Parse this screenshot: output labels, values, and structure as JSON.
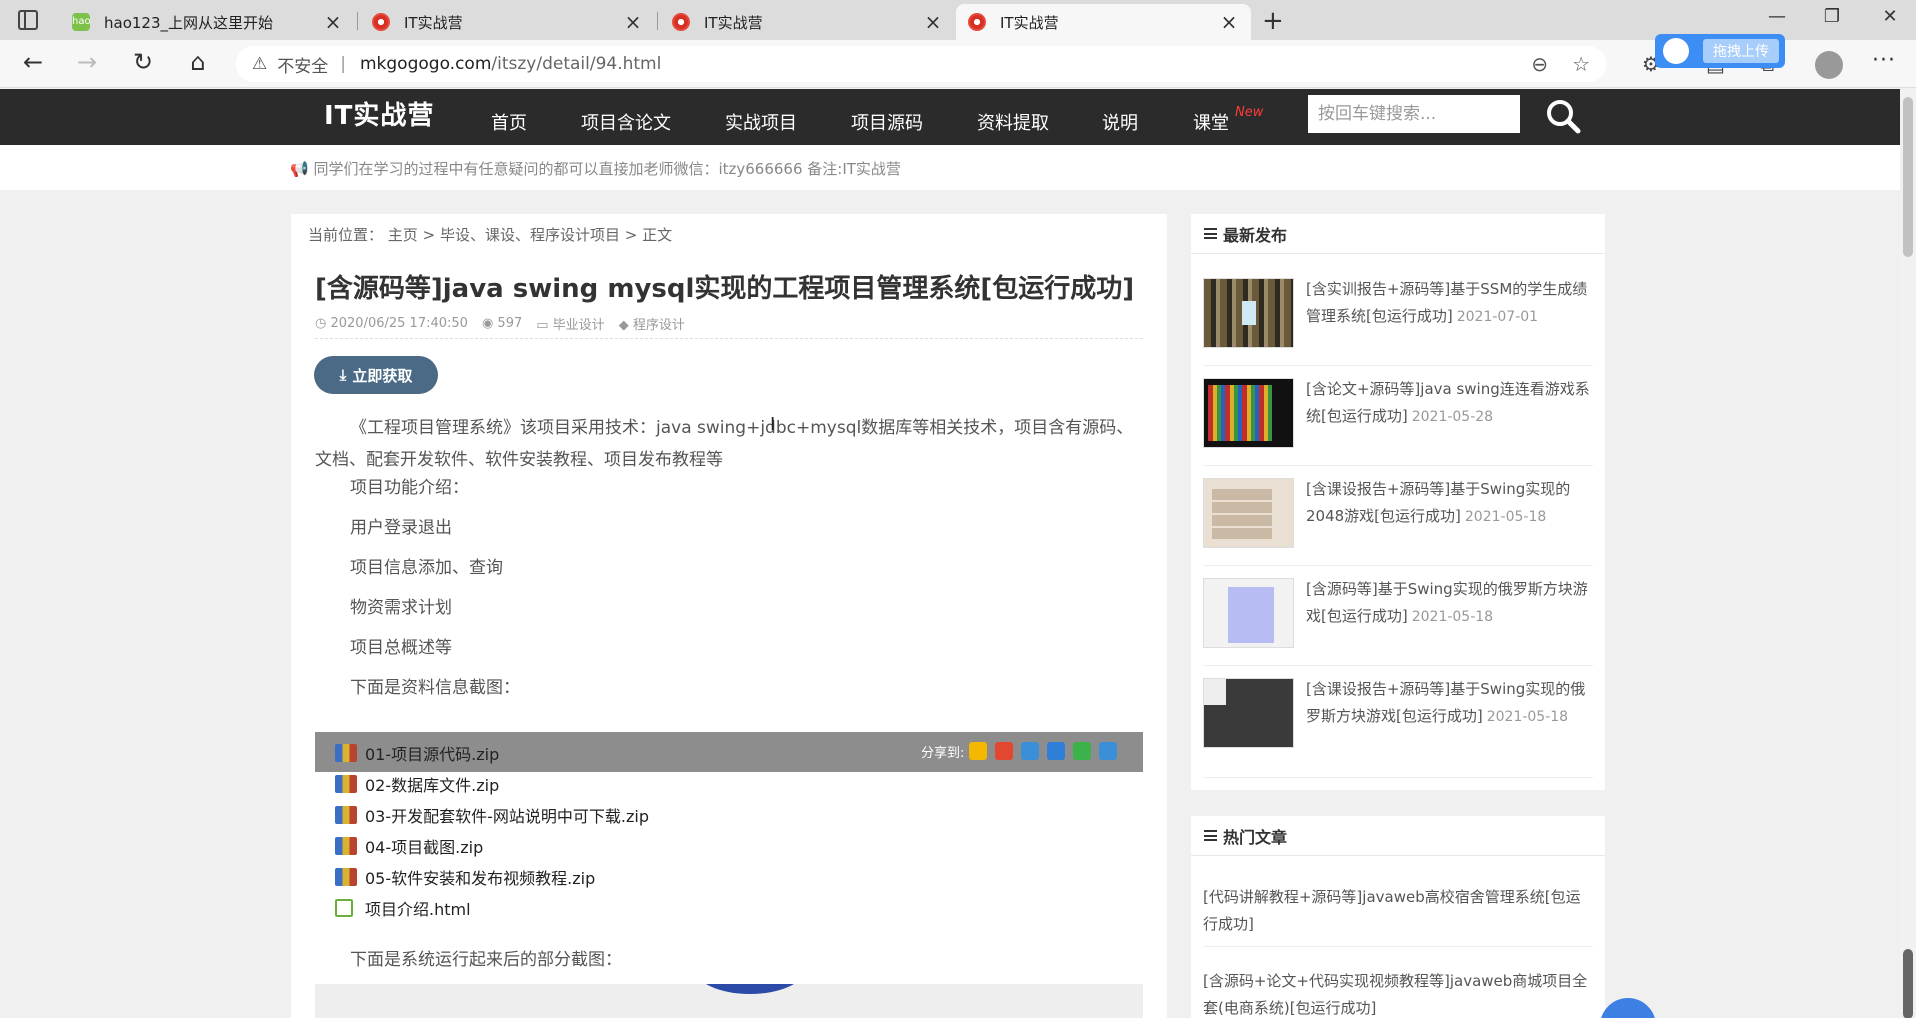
{
  "browser": {
    "tabs": [
      {
        "title": "hao123_上网从这里开始",
        "favicon": "hao123-icon",
        "active": false
      },
      {
        "title": "IT实战营",
        "favicon": "chrome-icon",
        "active": false
      },
      {
        "title": "IT实战营",
        "favicon": "chrome-icon",
        "active": false
      },
      {
        "title": "IT实战营",
        "favicon": "chrome-icon",
        "active": true
      }
    ],
    "insecure_label": "不安全",
    "url_host": "mkgogogo.com",
    "url_path": "/itszy/detail/94.html",
    "upload_badge": "拖拽上传"
  },
  "site": {
    "logo": "IT实战营",
    "nav": [
      "首页",
      "项目含论文",
      "实战项目",
      "项目源码",
      "资料提取",
      "说明",
      "课堂"
    ],
    "nav_new_badge": "New",
    "search_placeholder": "按回车键搜索...",
    "notice": "同学们在学习的过程中有任意疑问的都可以直接加老师微信：itzy666666 备注:IT实战营"
  },
  "article": {
    "breadcrumb": {
      "label": "当前位置：",
      "home": "主页",
      "sep": ">",
      "category": "毕设、课设、程序设计项目",
      "current": "正文"
    },
    "title": "[含源码等]java swing mysql实现的工程项目管理系统[包运行成功]",
    "meta": {
      "datetime": "2020/06/25 17:40:50",
      "views": "597",
      "category": "毕业设计",
      "tag": "程序设计"
    },
    "get_button": "立即获取",
    "intro": "《工程项目管理系统》该项目采用技术：java swing+jdbc+mysql数据库等相关技术，项目含有源码、文档、配套开发软件、软件安装教程、项目发布教程等",
    "features_title": "项目功能介绍：",
    "features": [
      "用户登录退出",
      "项目信息添加、查询",
      "物资需求计划",
      "项目总概述等"
    ],
    "files_hint": "下面是资料信息截图：",
    "share_label": "分享到:",
    "files": [
      "01-项目源代码.zip",
      "02-数据库文件.zip",
      "03-开发配套软件-网站说明中可下载.zip",
      "04-项目截图.zip",
      "05-软件安装和发布视频教程.zip",
      "项目介绍.html"
    ],
    "screens_hint": "下面是系统运行起来后的部分截图："
  },
  "sidebar": {
    "latest_title": "最新发布",
    "latest": [
      {
        "title": "[含实训报告+源码等]基于SSM的学生成绩管理系统[包运行成功]",
        "date": "2021-07-01"
      },
      {
        "title": "[含论文+源码等]java swing连连看游戏系统[包运行成功]",
        "date": "2021-05-28"
      },
      {
        "title": "[含课设报告+源码等]基于Swing实现的2048游戏[包运行成功]",
        "date": "2021-05-18"
      },
      {
        "title": "[含源码等]基于Swing实现的俄罗斯方块游戏[包运行成功]",
        "date": "2021-05-18"
      },
      {
        "title": "[含课设报告+源码等]基于Swing实现的俄罗斯方块游戏[包运行成功]",
        "date": "2021-05-18"
      }
    ],
    "hot_title": "热门文章",
    "hot": [
      "[代码讲解教程+源码等]javaweb高校宿舍管理系统[包运行成功]",
      "[含源码+论文+代码实现视频教程等]javaweb商城项目全套(电商系统)[包运行成功]"
    ]
  }
}
